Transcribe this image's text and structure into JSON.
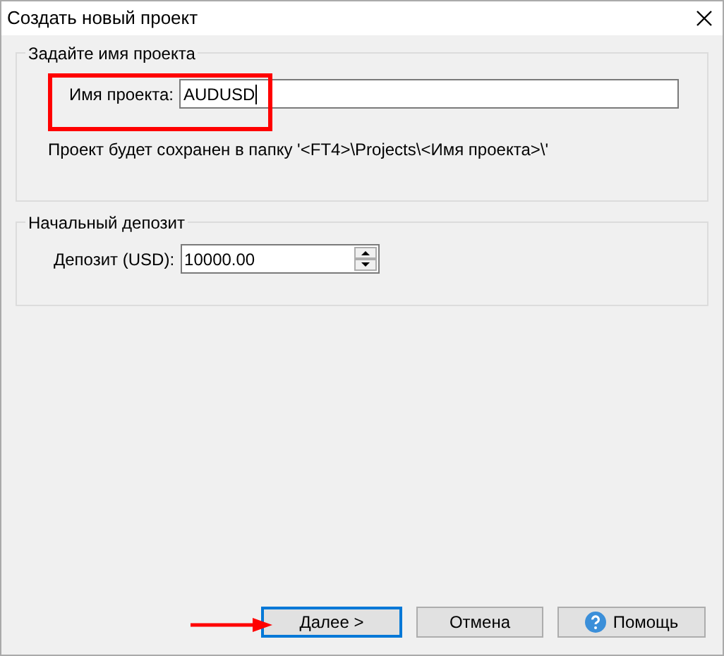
{
  "window": {
    "title": "Создать новый проект"
  },
  "project_group": {
    "title": "Задайте имя проекта",
    "name_label": "Имя проекта:",
    "name_value": "AUDUSD",
    "hint": "Проект будет сохранен в папку '<FT4>\\Projects\\<Имя проекта>\\'"
  },
  "deposit_group": {
    "title": "Начальный депозит",
    "deposit_label": "Депозит (USD):",
    "deposit_value": "10000.00"
  },
  "buttons": [
    {
      "label": "Далее >",
      "kind": "default"
    },
    {
      "label": "Отмена",
      "kind": "plain"
    },
    {
      "label": "Помощь",
      "kind": "help"
    }
  ]
}
